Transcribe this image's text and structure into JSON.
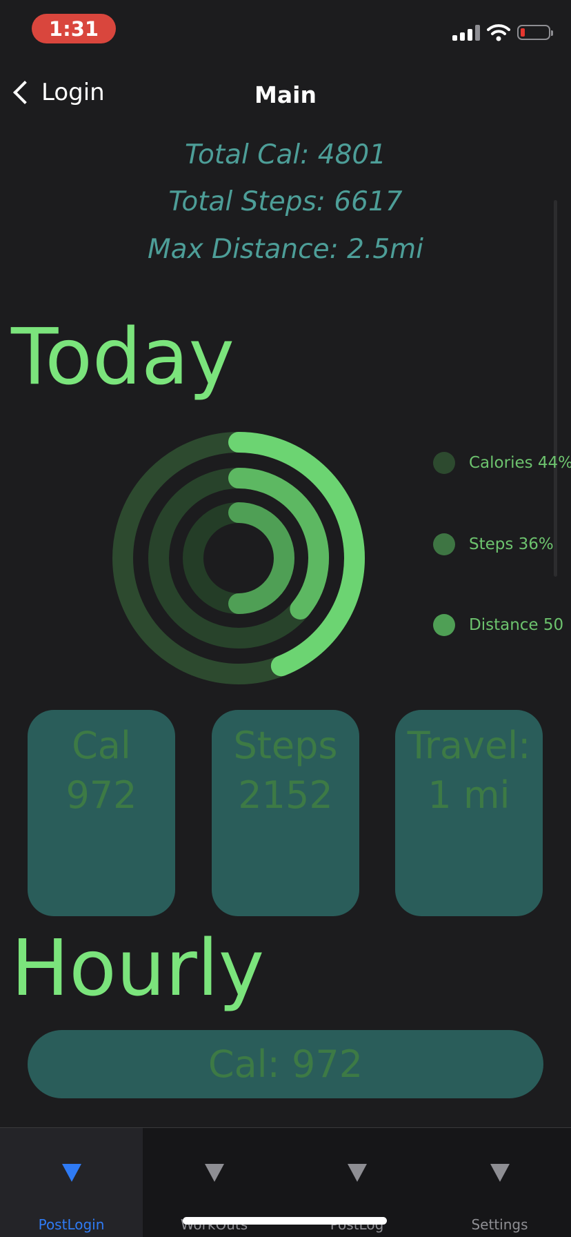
{
  "status_bar": {
    "time": "1:31",
    "icons": [
      "signal-icon",
      "wifi-icon",
      "battery-icon"
    ]
  },
  "nav": {
    "back_label": "Login",
    "title": "Main"
  },
  "totals": {
    "calories": "Total Cal: 4801",
    "steps": "Total Steps: 6617",
    "distance": "Max Distance: 2.5mi"
  },
  "today": {
    "title": "Today",
    "rings": [
      {
        "name": "Calories",
        "percent": 44,
        "color": "#6cd472",
        "track": "#2d4a2f"
      },
      {
        "name": "Steps",
        "percent": 36,
        "color": "#5db862",
        "track": "#28432b"
      },
      {
        "name": "Distance",
        "percent": 50,
        "color": "#4f9f55",
        "track": "#243d27"
      }
    ],
    "legend": [
      {
        "label": "Calories 44%",
        "color": "#2d4a2f"
      },
      {
        "label": "Steps 36%",
        "color": "#3e7543"
      },
      {
        "label": "Distance 50",
        "color": "#4f9f55"
      }
    ]
  },
  "cards": [
    {
      "title": "Cal",
      "value": "972"
    },
    {
      "title": "Steps",
      "value": "2152"
    },
    {
      "title": "Travel:",
      "value": "1 mi"
    }
  ],
  "hourly": {
    "title": "Hourly",
    "pill": "Cal: 972"
  },
  "tabs": [
    {
      "label": "PostLogin",
      "active": true
    },
    {
      "label": "WorkOuts",
      "active": false
    },
    {
      "label": "PostLog",
      "active": false
    },
    {
      "label": "Settings",
      "active": false
    }
  ]
}
